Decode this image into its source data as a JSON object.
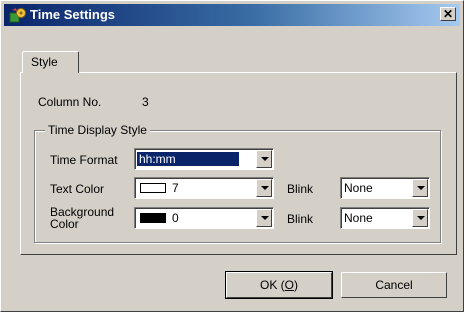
{
  "window": {
    "title": "Time Settings",
    "close_glyph": "✕",
    "app_icon": "settings-app-icon"
  },
  "tabs": [
    {
      "label": "Style",
      "active": true
    }
  ],
  "column": {
    "label": "Column No.",
    "value": "3"
  },
  "group": {
    "title": "Time Display Style",
    "time_format": {
      "label": "Time Format",
      "value": "hh:mm"
    },
    "text_color": {
      "label": "Text Color",
      "color_value": "7",
      "swatch_color": "#ffffff"
    },
    "background_color": {
      "label_line1": "Background",
      "label_line2": "Color",
      "color_value": "0",
      "swatch_color": "#000000"
    },
    "blink_label": "Blink",
    "text_blink_value": "None",
    "bg_blink_value": "None"
  },
  "buttons": {
    "ok_prefix": "OK (",
    "ok_accel": "O",
    "ok_suffix": ")",
    "cancel": "Cancel"
  },
  "colors": {
    "title_bar_start": "#0a246a",
    "title_bar_end": "#a6caf0",
    "face": "#d4d0c8",
    "selection": "#0a246a"
  }
}
